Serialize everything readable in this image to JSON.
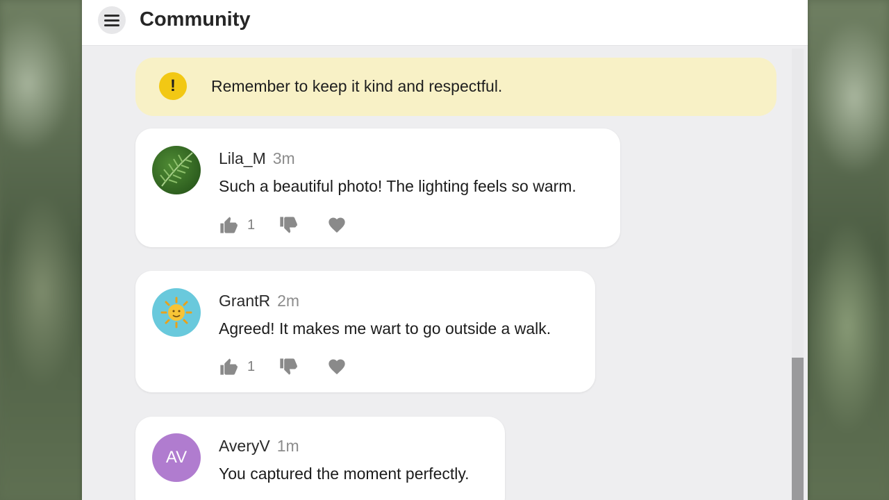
{
  "header": {
    "title": "Community",
    "menu_icon": "hamburger-menu-icon"
  },
  "notice": {
    "icon": "warning-icon",
    "icon_glyph": "!",
    "text": "Remember to keep it kind and respectful."
  },
  "comments": [
    {
      "author": "Lila_M",
      "time": "3m",
      "text": "Such a beautiful photo! The lighting feels so warm.",
      "avatar": "leaf-photo",
      "likes": "1"
    },
    {
      "author": "GrantR",
      "time": "2m",
      "text": "Agreed! It makes me wart to go outside a walk.",
      "avatar": "sun-emoji",
      "likes": "1"
    },
    {
      "author": "AveryV",
      "time": "1m",
      "text": "You captured the moment perfectly.",
      "avatar_initials": "AV"
    }
  ],
  "colors": {
    "notice_bg": "#f8f1c6",
    "notice_icon": "#f2c814",
    "avatar_avery": "#b07ccf",
    "avatar_grant": "#69c9dc",
    "action_icon": "#8a8a8a"
  }
}
